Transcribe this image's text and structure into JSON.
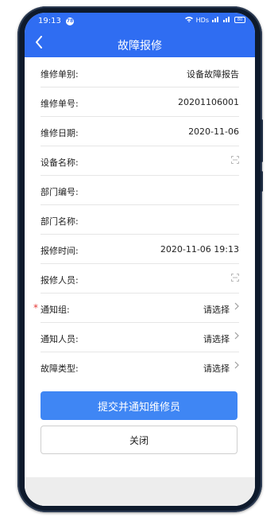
{
  "status_bar": {
    "time": "19:13",
    "badge": "78",
    "network_label": "HDs",
    "battery_label": "80"
  },
  "nav": {
    "title": "故障报修"
  },
  "form": {
    "rows": [
      {
        "label": "维修单别:",
        "value": "设备故障报告"
      },
      {
        "label": "维修单号:",
        "value": "20201106001"
      },
      {
        "label": "维修日期:",
        "value": "2020-11-06"
      },
      {
        "label": "设备名称:",
        "value": ""
      },
      {
        "label": "部门编号:",
        "value": ""
      },
      {
        "label": "部门名称:",
        "value": ""
      },
      {
        "label": "报修时间:",
        "value": "2020-11-06 19:13"
      },
      {
        "label": "报修人员:",
        "value": ""
      },
      {
        "label": "通知组:",
        "value": "请选择",
        "required_mark": "*"
      },
      {
        "label": "通知人员:",
        "value": "请选择"
      },
      {
        "label": "故障类型:",
        "value": "请选择"
      }
    ]
  },
  "buttons": {
    "submit": "提交并通知维修员",
    "close": "关闭"
  },
  "colors": {
    "header": "#2f6df2",
    "primary_button": "#3f86f4",
    "required": "#e53935"
  }
}
